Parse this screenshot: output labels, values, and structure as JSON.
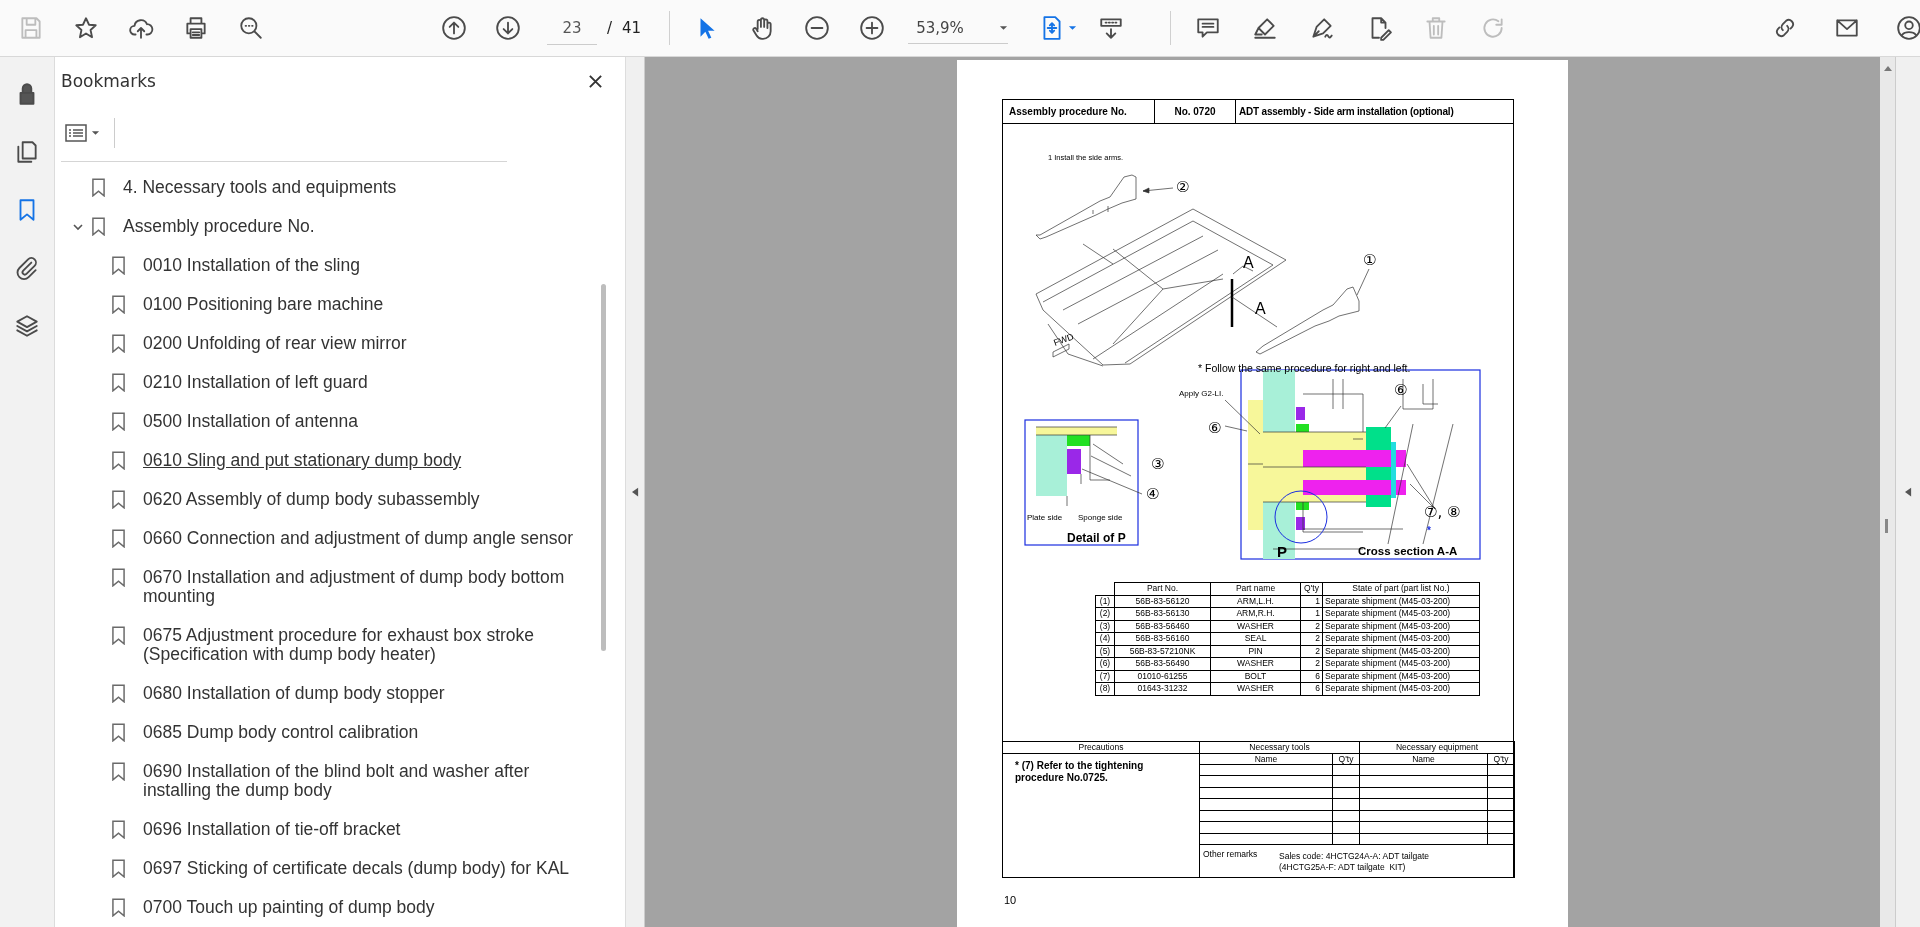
{
  "toolbar": {
    "tools_file": [
      {
        "kind": "save",
        "disabled": true
      },
      {
        "kind": "star",
        "disabled": false
      },
      {
        "kind": "upload",
        "disabled": false
      },
      {
        "kind": "print",
        "disabled": false
      },
      {
        "kind": "find",
        "disabled": false
      }
    ],
    "tools_page": [
      {
        "kind": "page-up",
        "disabled": false
      },
      {
        "kind": "page-down",
        "disabled": false
      }
    ],
    "page_current": "23",
    "page_separator": "/",
    "page_total": "41",
    "tools_view": [
      {
        "kind": "select",
        "selected": true
      },
      {
        "kind": "hand",
        "selected": false
      },
      {
        "kind": "zoom-out",
        "selected": false
      },
      {
        "kind": "zoom-in",
        "selected": false
      }
    ],
    "zoom": "53,9%",
    "tools_fit": [
      {
        "kind": "fit-page",
        "disabled": false
      },
      {
        "kind": "scroll-mode",
        "disabled": false
      }
    ],
    "tools_edit": [
      {
        "kind": "comment",
        "disabled": false
      },
      {
        "kind": "highlight",
        "disabled": false
      },
      {
        "kind": "sign",
        "disabled": false
      },
      {
        "kind": "edit-doc",
        "disabled": false
      },
      {
        "kind": "trash",
        "disabled": true
      },
      {
        "kind": "rotate",
        "disabled": true
      }
    ],
    "tools_share": [
      {
        "kind": "link",
        "disabled": false
      },
      {
        "kind": "mail",
        "disabled": false
      },
      {
        "kind": "account",
        "disabled": false
      }
    ]
  },
  "rail": [
    {
      "kind": "lock",
      "selected": false
    },
    {
      "kind": "pages",
      "selected": false
    },
    {
      "kind": "bookmarks",
      "selected": true
    },
    {
      "kind": "attachments",
      "selected": false
    },
    {
      "kind": "layers",
      "selected": false
    }
  ],
  "sidebar": {
    "title": "Bookmarks",
    "bookmarks": [
      {
        "label": "4. Necessary tools and equipments"
      },
      {
        "label": "Assembly procedure No.",
        "expanded": true,
        "children": [
          {
            "label": "0010 Installation of the sling",
            "hovered": false
          },
          {
            "label": "0100 Positioning bare machine",
            "hovered": false
          },
          {
            "label": "0200 Unfolding of rear view mirror",
            "hovered": false
          },
          {
            "label": "0210 Installation of left guard",
            "hovered": false
          },
          {
            "label": "0500 Installation of antenna",
            "hovered": false
          },
          {
            "label": "0610 Sling and put stationary dump body",
            "hovered": true
          },
          {
            "label": "0620 Assembly of dump body subassembly",
            "hovered": false
          },
          {
            "label": "0660 Connection and adjustment of dump angle sensor",
            "hovered": false
          },
          {
            "label": "0670 Installation and adjustment of dump body bottom mounting",
            "hovered": false
          },
          {
            "label": "0675 Adjustment procedure for exhaust box stroke (Specification with dump body heater)",
            "hovered": false
          },
          {
            "label": "0680 Installation of dump body stopper",
            "hovered": false
          },
          {
            "label": "0685 Dump body control calibration",
            "hovered": false
          },
          {
            "label": "0690 Installation of the blind bolt and washer after installing the dump body",
            "hovered": false
          },
          {
            "label": "0696 Installation of tie-off bracket",
            "hovered": false
          },
          {
            "label": "0697 Sticking of certificate decals (dump body) for KAL",
            "hovered": false
          },
          {
            "label": "0700 Touch up painting of dump body",
            "hovered": false
          }
        ]
      }
    ]
  },
  "document": {
    "header": [
      "Assembly procedure No.",
      "No. 0720",
      "ADT assembly - Side arm installation (optional)"
    ],
    "figure_labels": [
      "1 Install the side arms.",
      "②",
      "A",
      "A",
      "FWD",
      "①",
      "* Follow the same procedure for right and left.",
      "Apply G2-LI.",
      "⑥",
      "⑥",
      "③",
      "④",
      "Plate side",
      "Sponge side",
      "Detail of P",
      "⑦, ⑧",
      "*",
      "P",
      "Cross section A-A"
    ],
    "parts": {
      "columns": [
        "",
        "Part No.",
        "Part name",
        "Q'ty",
        "State of part (part list No.)"
      ],
      "rows": [
        [
          "(1)",
          "56B-83-56120",
          "ARM,L.H.",
          "1",
          "Separate shipment (M45-03-200)"
        ],
        [
          "(2)",
          "56B-83-56130",
          "ARM,R.H.",
          "1",
          "Separate shipment (M45-03-200)"
        ],
        [
          "(3)",
          "56B-83-56460",
          "WASHER",
          "2",
          "Separate shipment (M45-03-200)"
        ],
        [
          "(4)",
          "56B-83-56160",
          "SEAL",
          "2",
          "Separate shipment (M45-03-200)"
        ],
        [
          "(5)",
          "56B-83-57210NK",
          "PIN",
          "2",
          "Separate shipment (M45-03-200)"
        ],
        [
          "(6)",
          "56B-83-56490",
          "WASHER",
          "2",
          "Separate shipment (M45-03-200)"
        ],
        [
          "(7)",
          "01010-61255",
          "BOLT",
          "6",
          "Separate shipment (M45-03-200)"
        ],
        [
          "(8)",
          "01643-31232",
          "WASHER",
          "6",
          "Separate shipment (M45-03-200)"
        ]
      ]
    },
    "precautions": {
      "heading": "Precautions",
      "note": "* (7) Refer to the tightening procedure No.0725."
    },
    "tools": {
      "heading": "Necessary tools",
      "columns": [
        "Name",
        "Q'ty"
      ]
    },
    "equipment": {
      "heading": "Necessary equipment",
      "columns": [
        "Name",
        "Q'ty"
      ]
    },
    "remarks": {
      "label": "Other remarks",
      "lines": [
        "Sales code: 4HCTG24A-A: ADT tailgate",
        "(4HCTG25A-F: ADT tailgate  KIT)"
      ]
    },
    "page_number": "10"
  }
}
